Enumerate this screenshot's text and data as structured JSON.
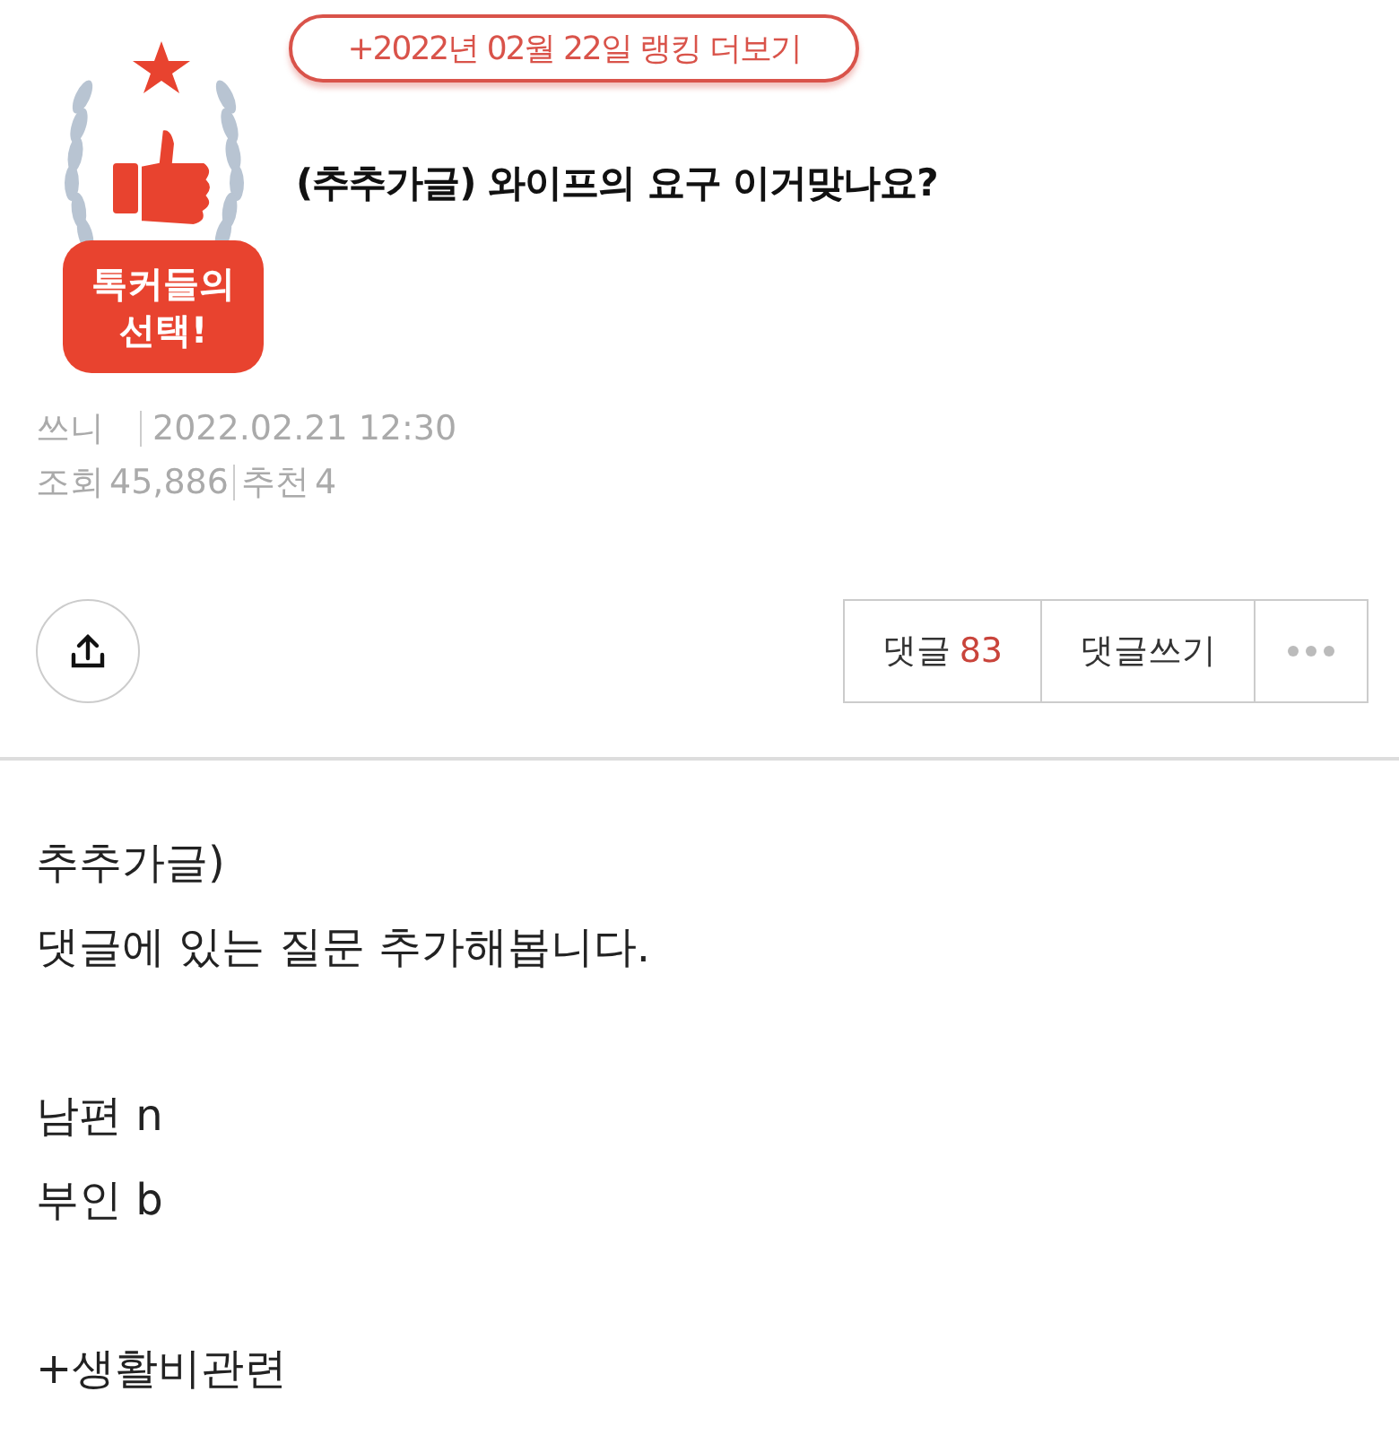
{
  "ranking_link": "+2022년 02월 22일 랭킹 더보기",
  "badge": {
    "lines": [
      "톡커들의",
      "선택!"
    ]
  },
  "title": "(추추가글) 와이프의 요구 이거맞나요?",
  "meta": {
    "author": "쓰니",
    "date": "2022.02.21 12:30",
    "views_label": "조회",
    "views": "45,886",
    "likes_label": "추천",
    "likes": "4"
  },
  "actions": {
    "comments_label": "댓글",
    "comments_count": "83",
    "write_comment": "댓글쓰기"
  },
  "body": [
    [
      "추추가글)",
      "댓글에 있는 질문 추가해봅니다."
    ],
    [
      "남편 n",
      "부인 b"
    ],
    [
      "+생활비관련"
    ]
  ]
}
